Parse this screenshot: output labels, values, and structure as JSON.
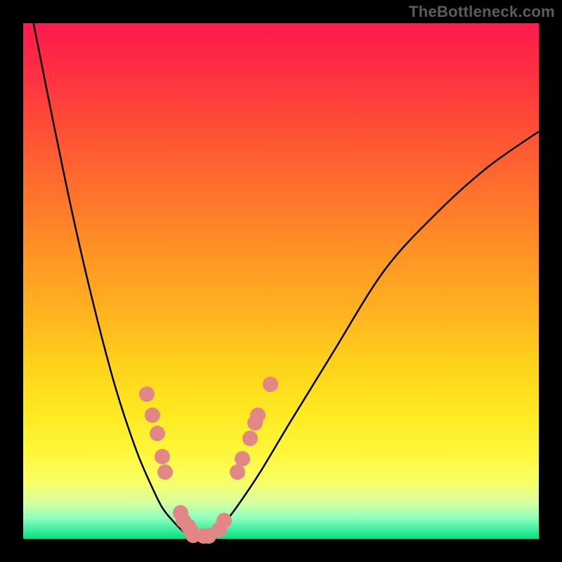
{
  "watermark": "TheBottleneck.com",
  "chart_data": {
    "type": "line",
    "title": "",
    "xlabel": "",
    "ylabel": "",
    "xlim": [
      0,
      100
    ],
    "ylim": [
      0,
      100
    ],
    "series": [
      {
        "name": "left-curve",
        "x": [
          2,
          6,
          10,
          14,
          18,
          22,
          25,
          27,
          29,
          31,
          33,
          35
        ],
        "y": [
          100,
          80,
          61,
          44,
          29,
          17,
          10,
          6,
          3.5,
          1.5,
          0.5,
          0
        ]
      },
      {
        "name": "right-curve",
        "x": [
          35,
          37,
          39,
          42,
          46,
          52,
          60,
          70,
          80,
          90,
          100
        ],
        "y": [
          0,
          1,
          3,
          7,
          13,
          23,
          36,
          52,
          63,
          72,
          79
        ]
      }
    ],
    "markers": [
      {
        "x": 24,
        "y": 28
      },
      {
        "x": 25,
        "y": 24
      },
      {
        "x": 26,
        "y": 20.5
      },
      {
        "x": 27,
        "y": 16
      },
      {
        "x": 27.5,
        "y": 13
      },
      {
        "x": 30.5,
        "y": 5
      },
      {
        "x": 31,
        "y": 3.5
      },
      {
        "x": 32,
        "y": 2.5
      },
      {
        "x": 32.5,
        "y": 1.5
      },
      {
        "x": 33,
        "y": 0.7
      },
      {
        "x": 35,
        "y": 0.5
      },
      {
        "x": 36,
        "y": 0.6
      },
      {
        "x": 38,
        "y": 1.8
      },
      {
        "x": 39,
        "y": 3.5
      },
      {
        "x": 41.5,
        "y": 13
      },
      {
        "x": 42.5,
        "y": 15.5
      },
      {
        "x": 44,
        "y": 19.5
      },
      {
        "x": 45,
        "y": 22.5
      },
      {
        "x": 45.5,
        "y": 24
      },
      {
        "x": 48,
        "y": 30
      }
    ],
    "background_gradient": {
      "top": "#ff1a4d",
      "middle": "#ffd11c",
      "bottom": "#00e083"
    }
  }
}
